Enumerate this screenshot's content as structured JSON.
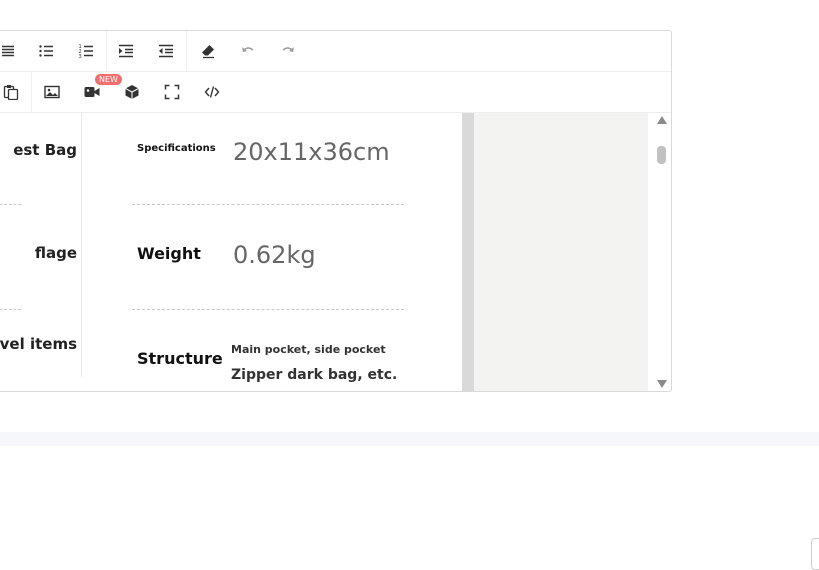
{
  "toolbar": {
    "new_badge": "NEW"
  },
  "left_column": {
    "row1": "est Bag",
    "row2": "flage",
    "row3": "vel items"
  },
  "specs": {
    "specifications_label": "Specifications",
    "specifications_value": "20x11x36cm",
    "weight_label": "Weight",
    "weight_value": "0.62kg",
    "structure_label": "Structure",
    "structure_line1": "Main pocket, side pocket",
    "structure_line2": "Zipper dark bag, etc."
  },
  "colors": {
    "badge": "#f26d6d",
    "icon": "#333333",
    "icon_disabled": "#9a9a9a",
    "canvas_gray": "#f3f3f1"
  },
  "icons": {
    "toolbar_row1": [
      "justify-icon",
      "bulleted-list-icon",
      "numbered-list-icon",
      "indent-icon",
      "outdent-icon",
      "clear-format-icon",
      "undo-icon",
      "redo-icon"
    ],
    "toolbar_row2": [
      "paste-icon",
      "image-icon",
      "video-icon",
      "3d-model-icon",
      "fullscreen-icon",
      "source-code-icon"
    ]
  }
}
